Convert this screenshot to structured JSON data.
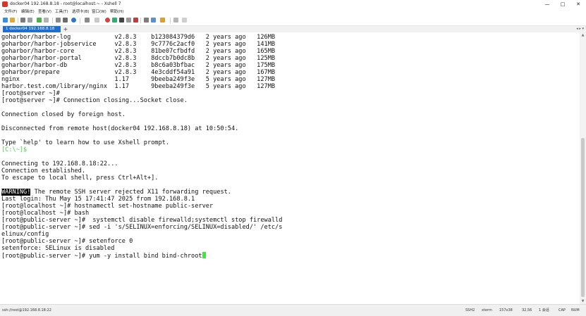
{
  "window": {
    "title": "docker04 192.168.8.18 - root@localhost:~ - Xshell 7",
    "controls": [
      "—",
      "□",
      "✕"
    ]
  },
  "menu": [
    "文件(F)",
    "编辑(E)",
    "查看(V)",
    "工具(T)",
    "选项卡(B)",
    "窗口(W)",
    "帮助(H)"
  ],
  "tab": {
    "label": "1 docker04 192.168.8.18",
    "add": "+",
    "nav": "◂ ▸ ▾"
  },
  "terminal": {
    "lines": [
      "goharbor/harbor-log            v2.8.3    b123084379d6   2 years ago   126MB",
      "goharbor/harbor-jobservice     v2.8.3    9c7776c2acf0   2 years ago   141MB",
      "goharbor/harbor-core           v2.8.3    81be07cfbdfd   2 years ago   165MB",
      "goharbor/harbor-portal         v2.8.3    8dccb7b0dc8b   2 years ago   125MB",
      "goharbor/harbor-db             v2.8.3    b8c6a03bfbac   2 years ago   175MB",
      "goharbor/prepare               v2.8.3    4e3cddf54a91   2 years ago   167MB",
      "nginx                          1.17      9beeba249f3e   5 years ago   127MB",
      "harbor.test.com/library/nginx  1.17      9beeba249f3e   5 years ago   127MB",
      "[root@server ~]#",
      "[root@server ~]# Connection closing...Socket close.",
      "",
      "Connection closed by foreign host.",
      "",
      "Disconnected from remote host(docker04 192.168.8.18) at 10:50:54.",
      "",
      "Type `help' to learn how to use Xshell prompt.",
      "[C:\\~]$",
      "",
      "Connecting to 192.168.8.18:22...",
      "Connection established.",
      "To escape to local shell, press Ctrl+Alt+].",
      "",
      "",
      "Last login: Thu May 15 17:41:47 2025 from 192.168.8.1",
      "[root@localhost ~]# hostnamectl set-hostname public-server",
      "[root@localhost ~]# bash",
      "[root@public-server ~]#  systemctl disable firewalld;systemctl stop firewalld",
      "[root@public-server ~]# sed -i 's/SELINUX=enforcing/SELINUX=disabled/' /etc/s",
      "elinux/config",
      "[root@public-server ~]# setenforce 0",
      "setenforce: SELinux is disabled",
      ""
    ],
    "warning_badge": "WARNING!",
    "warning_text": " The remote SSH server rejected X11 forwarding request.",
    "prompt": "[root@public-server ~]# ",
    "current_command": "yum -y install bind bind-chroot"
  },
  "status": {
    "connection": "ssh://root@192.168.8.18:22",
    "protocol": "SSH2",
    "terminal_type": "xterm",
    "size": "157x38",
    "cursor_pos": "32,56",
    "sessions": "1 会话",
    "caps": "CAP",
    "num": "NUM"
  },
  "colors": {
    "tab_active": "#1f6fd0",
    "local_prompt": "#4fd14f",
    "cursor": "#3ee83e"
  }
}
